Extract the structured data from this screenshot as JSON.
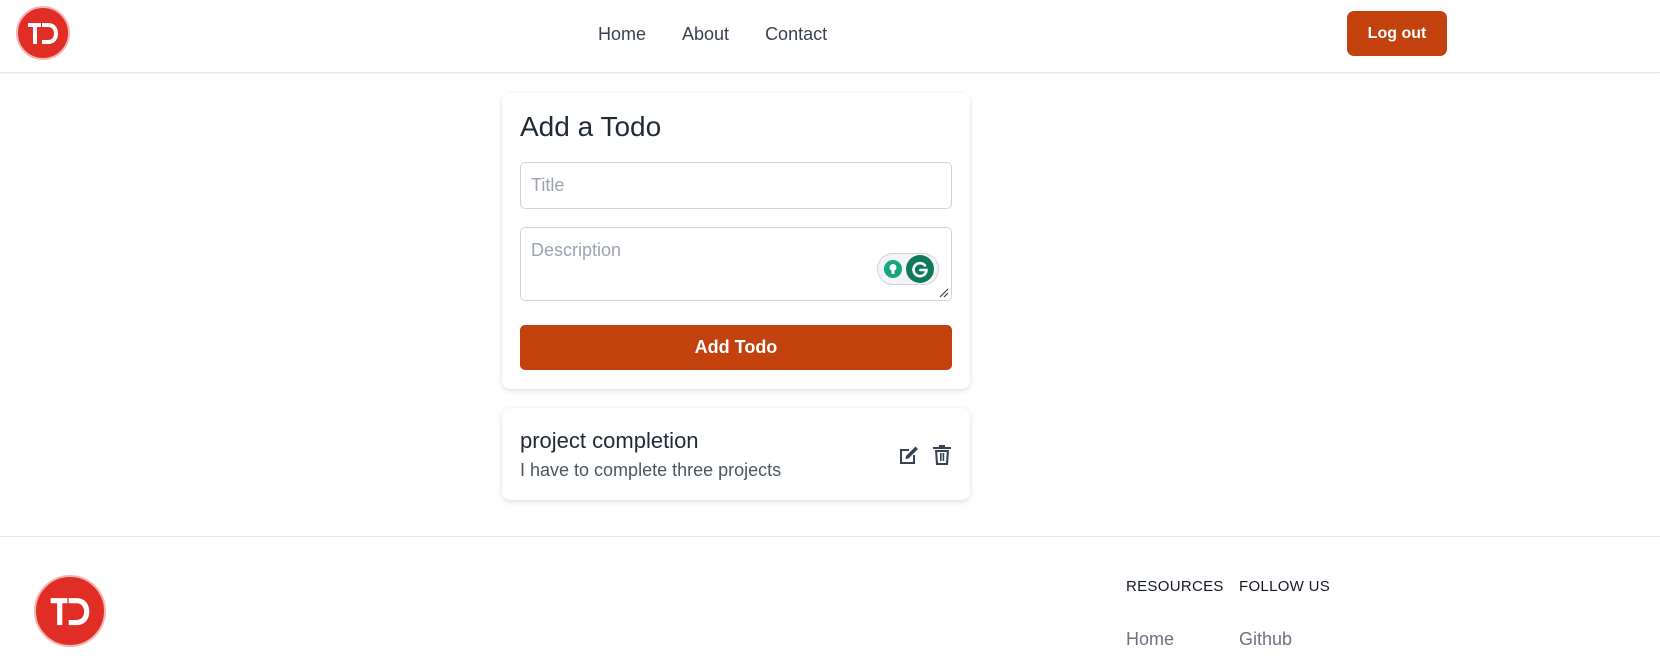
{
  "header": {
    "logo_text": "TD",
    "nav": [
      {
        "label": "Home"
      },
      {
        "label": "About"
      },
      {
        "label": "Contact"
      }
    ],
    "logout_label": "Log out"
  },
  "form": {
    "title": "Add a Todo",
    "title_placeholder": "Title",
    "title_value": "",
    "description_placeholder": "Description",
    "description_value": "",
    "submit_label": "Add Todo",
    "grammarly_icon": "grammarly-icon"
  },
  "todos": [
    {
      "title": "project completion",
      "description": "I have to complete three projects",
      "edit_icon": "edit-icon",
      "delete_icon": "trash-icon"
    }
  ],
  "footer": {
    "logo_text": "TD",
    "resources": {
      "heading": "RESOURCES",
      "links": [
        {
          "label": "Home"
        }
      ]
    },
    "follow": {
      "heading": "FOLLOW US",
      "links": [
        {
          "label": "Github"
        }
      ]
    }
  },
  "colors": {
    "accent": "#c2410c",
    "logo_red": "#e02d26",
    "grammarly_green": "#15a77a"
  }
}
